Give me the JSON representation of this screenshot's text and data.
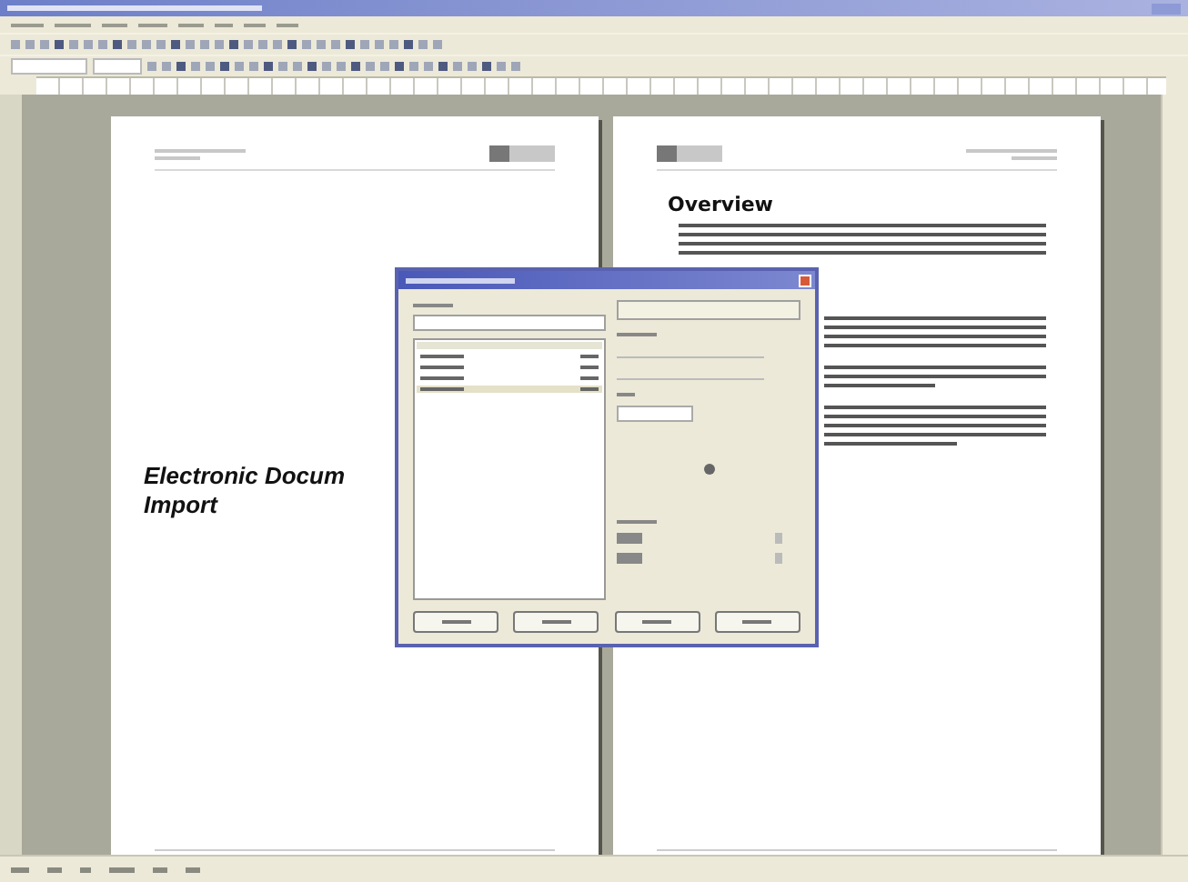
{
  "document": {
    "cover_page": {
      "title_lines": [
        "Electronic Docum",
        "Import"
      ]
    },
    "content_page": {
      "heading": "Overview"
    }
  },
  "dialog": {
    "list_rows": [
      {
        "selected": false
      },
      {
        "selected": false
      },
      {
        "selected": false
      },
      {
        "selected": true
      }
    ]
  }
}
